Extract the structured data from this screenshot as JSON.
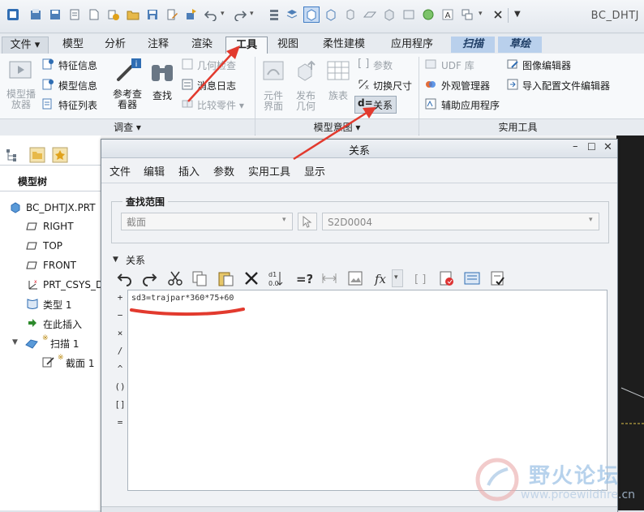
{
  "app": {
    "title": "BC_DHTJX.PRT - Creo Parametric",
    "title_short": "BC_DHTJ"
  },
  "tabs": [
    {
      "label": "文件 ▾"
    },
    {
      "label": "模型"
    },
    {
      "label": "分析"
    },
    {
      "label": "注释"
    },
    {
      "label": "渲染"
    },
    {
      "label": "工具"
    },
    {
      "label": "视图"
    },
    {
      "label": "柔性建模"
    },
    {
      "label": "应用程序"
    },
    {
      "label": "扫描"
    },
    {
      "label": "草绘"
    }
  ],
  "ribbon": {
    "investigate": {
      "model_player": "模型播\n放器",
      "feature_info": "特征信息",
      "model_info": "模型信息",
      "feature_list": "特征列表",
      "reference_viewer": "参考查\n看器",
      "find": "查找",
      "geometry_check": "几何检查",
      "message_log": "消息日志",
      "compare_parts": "比较零件 ▾",
      "group_label": "调查 ▾"
    },
    "model_intent": {
      "component_interface": "元件\n界面",
      "publish_geometry": "发布\n几何",
      "family_table": "族表",
      "parameters": "参数",
      "switch_dimensions": "切换尺寸",
      "relations": "关系",
      "group_label": "模型意图 ▾"
    },
    "utilities": {
      "udf_library": "UDF 库",
      "appearance_manager": "外观管理器",
      "auxiliary_apps": "辅助应用程序",
      "image_editor": "图像编辑器",
      "import_config_editor": "导入配置文件编辑器",
      "group_label": "实用工具"
    }
  },
  "model_tree": {
    "title": "模型树",
    "items": [
      {
        "label": "BC_DHTJX.PRT"
      },
      {
        "label": "RIGHT"
      },
      {
        "label": "TOP"
      },
      {
        "label": "FRONT"
      },
      {
        "label": "PRT_CSYS_D"
      },
      {
        "label": "类型 1"
      },
      {
        "label": "在此插入"
      },
      {
        "label": "扫描 1"
      },
      {
        "label": "截面 1"
      }
    ]
  },
  "dialog": {
    "title": "关系",
    "menu": [
      "文件",
      "编辑",
      "插入",
      "参数",
      "实用工具",
      "显示"
    ],
    "lookin_label": "查找范围",
    "lookin_type": "截面",
    "lookin_object": "S2D0004",
    "relations_label": "关系",
    "operators": [
      "+",
      "−",
      "×",
      "/",
      "^",
      "()",
      "[]",
      "="
    ],
    "relation_text": "sd3=trajpar*360*75+60"
  },
  "colors": {
    "annotation_red": "#e23a2e",
    "special_tab": "#b9d0ec",
    "active_tab_bg": "#f7f9fb"
  },
  "watermark": {
    "text": "野火论坛",
    "url": "www.proewildfire.cn"
  }
}
